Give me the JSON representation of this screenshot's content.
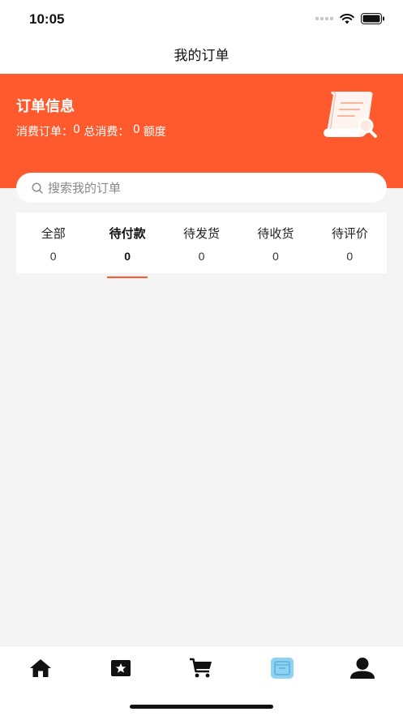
{
  "status_bar": {
    "time": "10:05"
  },
  "nav": {
    "title": "我的订单"
  },
  "hero": {
    "title": "订单信息",
    "orders_label": "消费订单：",
    "orders_value": "0",
    "total_label": " 总消费：",
    "total_value": " 0",
    "quota_label": "额度"
  },
  "search": {
    "placeholder": "搜索我的订单"
  },
  "tabs": [
    {
      "label": "全部",
      "count": "0"
    },
    {
      "label": "待付款",
      "count": "0"
    },
    {
      "label": "待发货",
      "count": "0"
    },
    {
      "label": "待收货",
      "count": "0"
    },
    {
      "label": "待评价",
      "count": "0"
    }
  ],
  "active_tab": "待付款",
  "tabbar": [
    {
      "icon": "home-icon"
    },
    {
      "icon": "star-icon"
    },
    {
      "icon": "cart-icon"
    },
    {
      "icon": "orders-icon"
    },
    {
      "icon": "user-icon"
    }
  ],
  "colors": {
    "accent": "#ff5a2d",
    "active_tab_icon": "#8fd3f4"
  }
}
